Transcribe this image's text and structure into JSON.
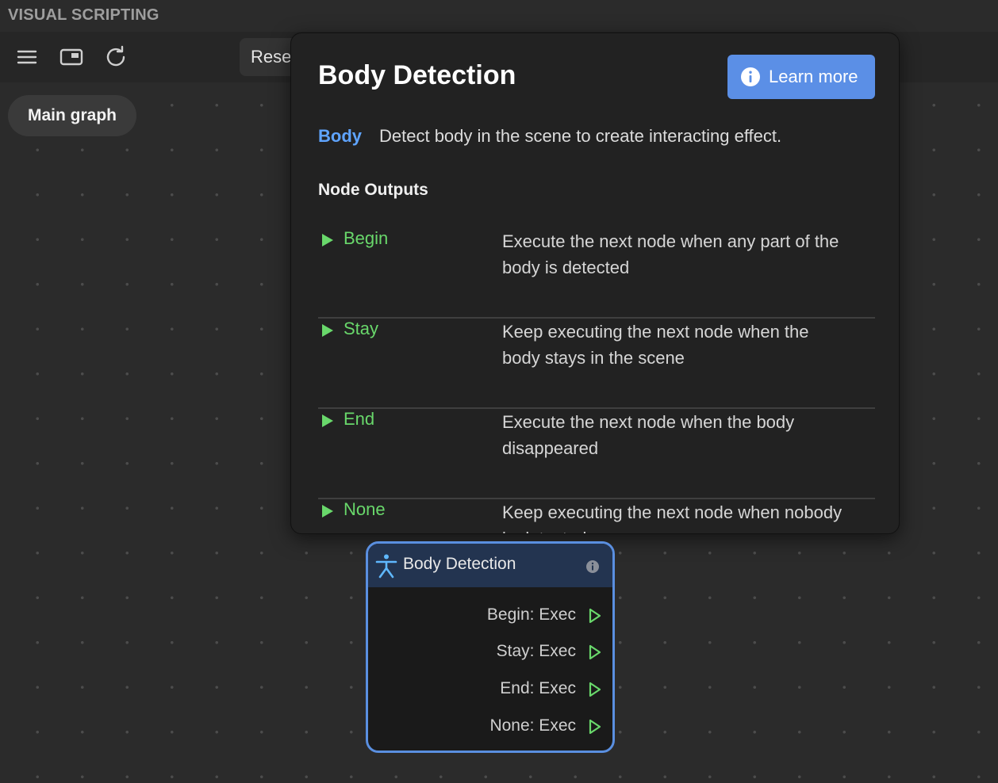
{
  "header": {
    "panel_title": "VISUAL SCRIPTING",
    "reset_label": "Reset"
  },
  "toolbar": {
    "icons": [
      "menu-icon",
      "window-icon",
      "refresh-icon"
    ]
  },
  "graph_tab": {
    "label": "Main graph"
  },
  "popup": {
    "title": "Body Detection",
    "learn_more_label": "Learn more",
    "category": "Body",
    "description": "Detect body in the scene to create interacting effect.",
    "outputs_heading": "Node Outputs",
    "outputs": [
      {
        "name": "Begin",
        "desc": "Execute the next node when any part of the body is detected"
      },
      {
        "name": "Stay",
        "desc": "Keep executing the next node when the body stays in the scene"
      },
      {
        "name": "End",
        "desc": "Execute the next node when the body disappeared"
      },
      {
        "name": "None",
        "desc": "Keep executing the next node when nobody is detected"
      }
    ]
  },
  "node": {
    "title": "Body Detection",
    "ports": [
      "Begin: Exec",
      "Stay: Exec",
      "End: Exec",
      "None: Exec"
    ]
  },
  "colors": {
    "accent_blue": "#5b8fe6",
    "category_blue": "#5fa4ff",
    "exec_green": "#69d86b",
    "node_border": "#5a8fe0",
    "node_header": "#233450"
  }
}
